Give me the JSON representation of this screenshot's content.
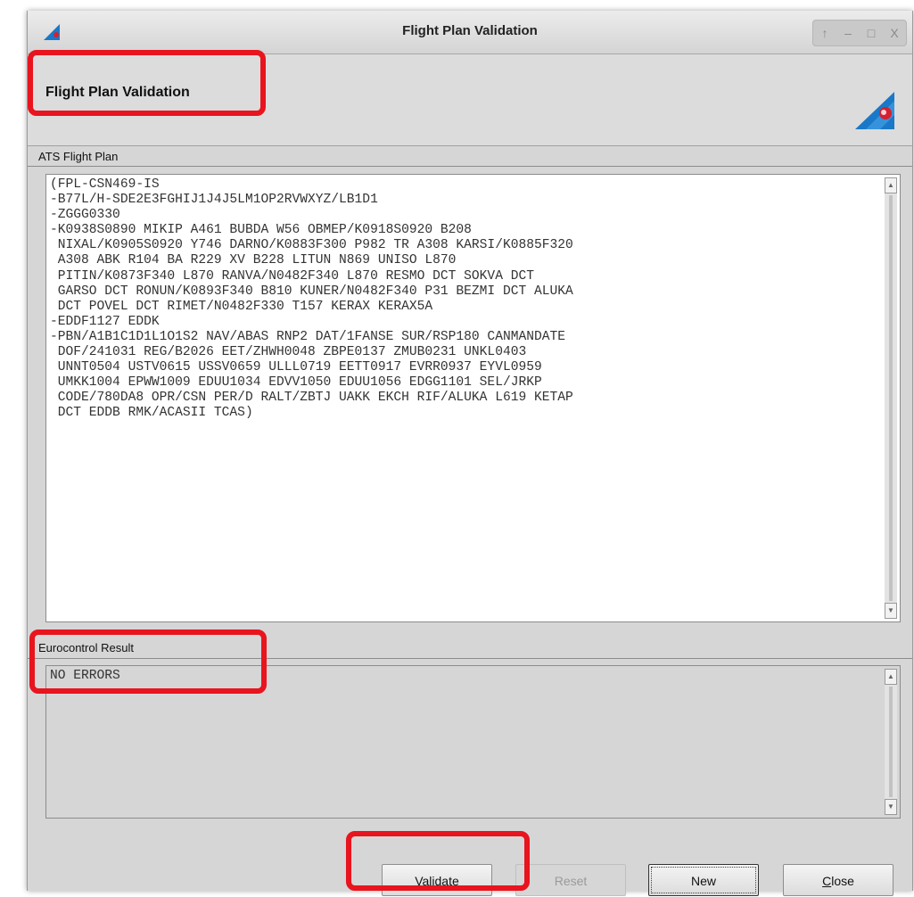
{
  "window": {
    "title": "Flight Plan Validation",
    "controls": {
      "up": "↑",
      "minimize": "–",
      "maximize": "□",
      "close": "X"
    }
  },
  "header": {
    "title": "Flight Plan Validation"
  },
  "ats_section": {
    "label": "ATS Flight Plan",
    "text": "(FPL-CSN469-IS\n-B77L/H-SDE2E3FGHIJ1J4J5LM1OP2RVWXYZ/LB1D1\n-ZGGG0330\n-K0938S0890 MIKIP A461 BUBDA W56 OBMEP/K0918S0920 B208\n NIXAL/K0905S0920 Y746 DARNO/K0883F300 P982 TR A308 KARSI/K0885F320\n A308 ABK R104 BA R229 XV B228 LITUN N869 UNISO L870\n PITIN/K0873F340 L870 RANVA/N0482F340 L870 RESMO DCT SOKVA DCT\n GARSO DCT RONUN/K0893F340 B810 KUNER/N0482F340 P31 BEZMI DCT ALUKA\n DCT POVEL DCT RIMET/N0482F330 T157 KERAX KERAX5A\n-EDDF1127 EDDK\n-PBN/A1B1C1D1L1O1S2 NAV/ABAS RNP2 DAT/1FANSE SUR/RSP180 CANMANDATE\n DOF/241031 REG/B2026 EET/ZHWH0048 ZBPE0137 ZMUB0231 UNKL0403\n UNNT0504 USTV0615 USSV0659 ULLL0719 EETT0917 EVRR0937 EYVL0959\n UMKK1004 EPWW1009 EDUU1034 EDVV1050 EDUU1056 EDGG1101 SEL/JRKP\n CODE/780DA8 OPR/CSN PER/D RALT/ZBTJ UAKK EKCH RIF/ALUKA L619 KETAP\n DCT EDDB RMK/ACASII TCAS)"
  },
  "result_section": {
    "label": "Eurocontrol Result",
    "text": "NO ERRORS"
  },
  "buttons": {
    "validate": "Validate",
    "reset": "Reset",
    "new": "New",
    "close_prefix": "C",
    "close_rest": "lose"
  },
  "colors": {
    "highlight": "#e8141e",
    "logo_blue": "#1a78c8",
    "logo_red": "#d62030"
  },
  "icons": [
    "app-logo-icon",
    "scroll-up-arrow-icon",
    "scroll-down-arrow-icon"
  ]
}
